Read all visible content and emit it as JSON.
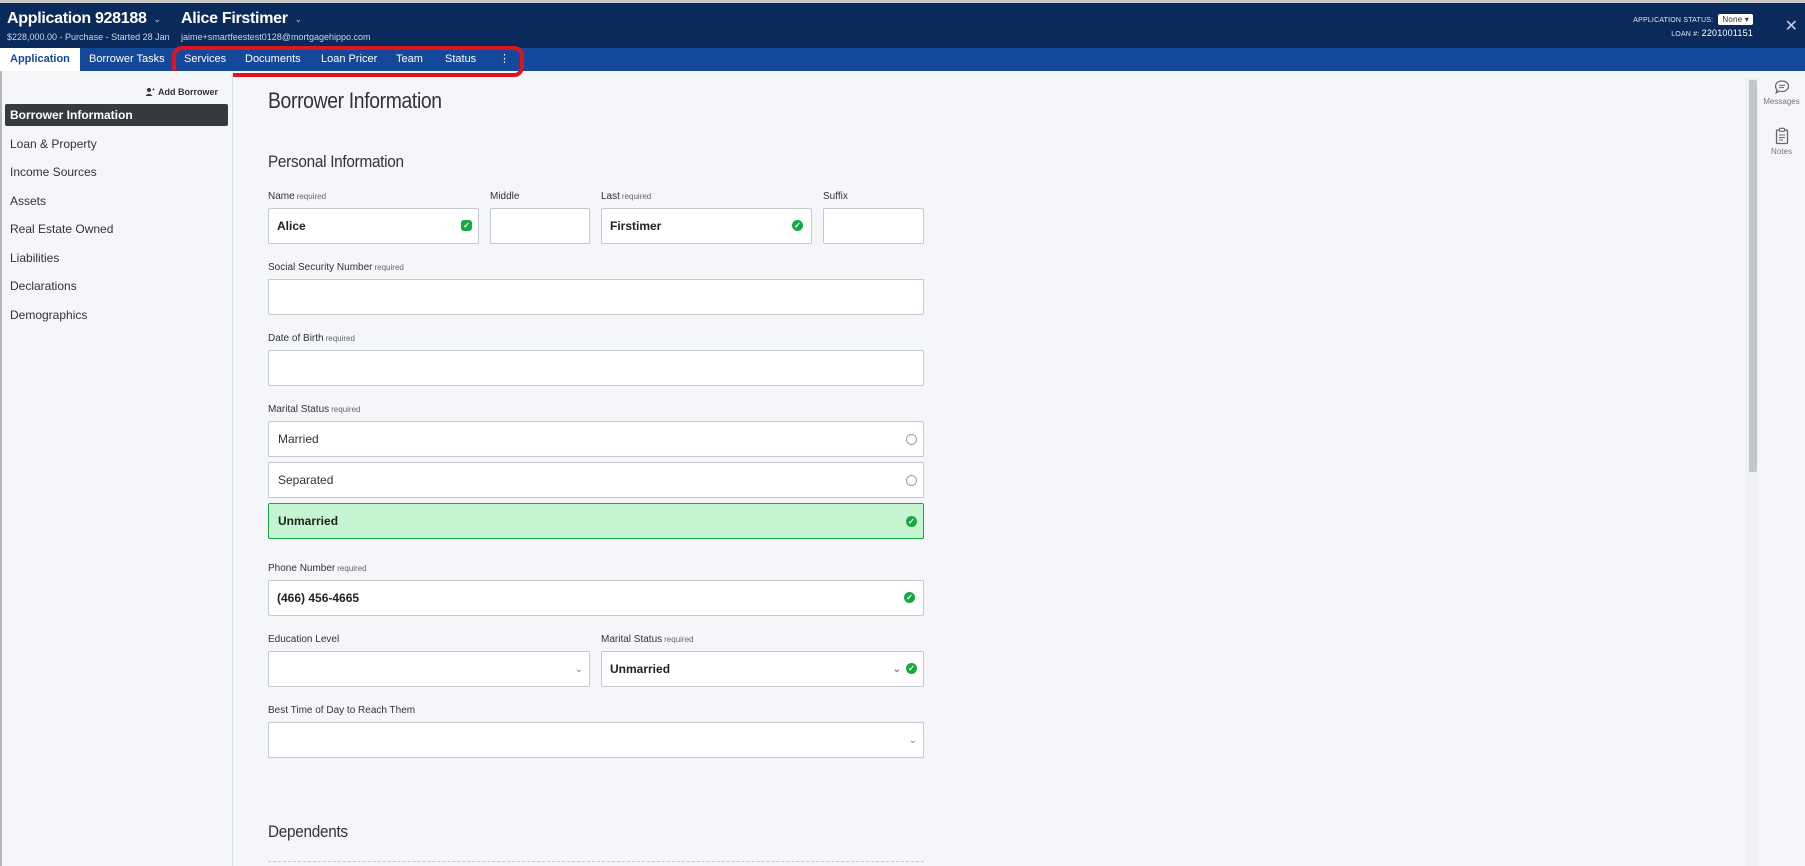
{
  "header": {
    "app_title": "Application 928188",
    "app_sub": "$228,000.00 - Purchase - Started 28 Jan",
    "borrower_name": "Alice Firstimer",
    "borrower_email": "jaime+smartfeestest0128@mortgagehippo.com",
    "status_label": "APPLICATION STATUS:",
    "status_value": "None",
    "loan_label": "LOAN #:",
    "loan_number": "2201001151"
  },
  "tabs": [
    {
      "label": "Application"
    },
    {
      "label": "Borrower Tasks"
    },
    {
      "label": "Services"
    },
    {
      "label": "Documents"
    },
    {
      "label": "Loan Pricer"
    },
    {
      "label": "Team"
    },
    {
      "label": "Status"
    },
    {
      "label": "⋮"
    }
  ],
  "sidebar": {
    "add_borrower": "Add Borrower",
    "items": [
      {
        "label": "Borrower Information"
      },
      {
        "label": "Loan & Property"
      },
      {
        "label": "Income Sources"
      },
      {
        "label": "Assets"
      },
      {
        "label": "Real Estate Owned"
      },
      {
        "label": "Liabilities"
      },
      {
        "label": "Declarations"
      },
      {
        "label": "Demographics"
      }
    ]
  },
  "main": {
    "page_title": "Borrower Information",
    "personal_title": "Personal Information",
    "required": "required",
    "name_label": "Name",
    "name_value": "Alice",
    "middle_label": "Middle",
    "middle_value": "",
    "last_label": "Last",
    "last_value": "Firstimer",
    "suffix_label": "Suffix",
    "suffix_value": "",
    "ssn_label": "Social Security Number",
    "ssn_value": "",
    "dob_label": "Date of Birth",
    "dob_value": "",
    "marital_label": "Marital Status",
    "marital_options": [
      {
        "label": "Married",
        "selected": false
      },
      {
        "label": "Separated",
        "selected": false
      },
      {
        "label": "Unmarried",
        "selected": true
      }
    ],
    "phone_label": "Phone Number",
    "phone_value": "(466) 456-4665",
    "education_label": "Education Level",
    "education_value": "",
    "marital2_label": "Marital Status",
    "marital2_value": "Unmarried",
    "best_time_label": "Best Time of Day to Reach Them",
    "best_time_value": "",
    "dependents_title": "Dependents"
  },
  "rail": {
    "messages": "Messages",
    "notes": "Notes"
  },
  "colors": {
    "header_bg": "#0b2a5c",
    "tabbar_bg": "#14489a",
    "success": "#18a843",
    "selected_bg": "#c4f5d0",
    "highlight": "#e0141e"
  }
}
